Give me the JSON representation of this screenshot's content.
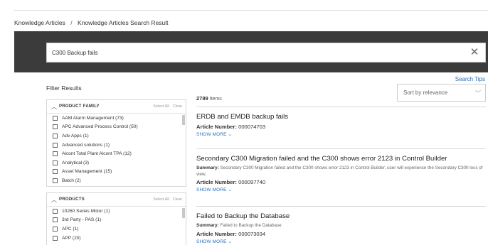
{
  "breadcrumb": {
    "first": "Knowledge Articles",
    "separator": "/",
    "current": "Knowledge Articles Search Result"
  },
  "search": {
    "value": "C300 Backup fails",
    "clear_glyph": "✕"
  },
  "search_tips": "Search Tips",
  "filter": {
    "title": "Filter Results",
    "facets": [
      {
        "title": "PRODUCT FAMILY",
        "select_all": "Select All",
        "clear": "Clear",
        "items": [
          "AAM Alarm Management (73)",
          "APC Advanced Process Control (50)",
          "Adv Apps (1)",
          "Advanced solutions (1)",
          "Alcont Total Plant Alcont TPA (12)",
          "Analytical (3)",
          "Asset Management (15)",
          "Batch (2)"
        ]
      },
      {
        "title": "PRODUCTS",
        "select_all": "Select All",
        "clear": "Clear",
        "items": [
          "10260 Series Motor (1)",
          "3rd Party - PAS (1)",
          "APC (1)",
          "APP (20)"
        ]
      }
    ]
  },
  "results": {
    "count": "2789",
    "count_suffix": "Items",
    "sort_label": "Sort by relevance",
    "items": [
      {
        "title": "ERDB and EMDB backup fails",
        "summary_label": "",
        "summary": "",
        "article_label": "Article Number:",
        "article_number": "000074703",
        "show_more": "SHOW MORE"
      },
      {
        "title": "Secondary C300 Migration failed and the C300 shows error 2123 in Control Builder",
        "summary_label": "Summary:",
        "summary": "Secondary C300 Migration failed and the C300 shows error 2123 in Control Builder, user will experience the Secondary C300 loss of view.",
        "article_label": "Article Number:",
        "article_number": "000097740",
        "show_more": "SHOW MORE"
      },
      {
        "title": "Failed to Backup the Database",
        "summary_label": "Summary:",
        "summary": "Failed to Backup the Database",
        "article_label": "Article Number:",
        "article_number": "000073034",
        "show_more": "SHOW MORE"
      }
    ]
  },
  "colors": {
    "search_band": "#3b3b3b",
    "link": "#2a6ebb"
  }
}
